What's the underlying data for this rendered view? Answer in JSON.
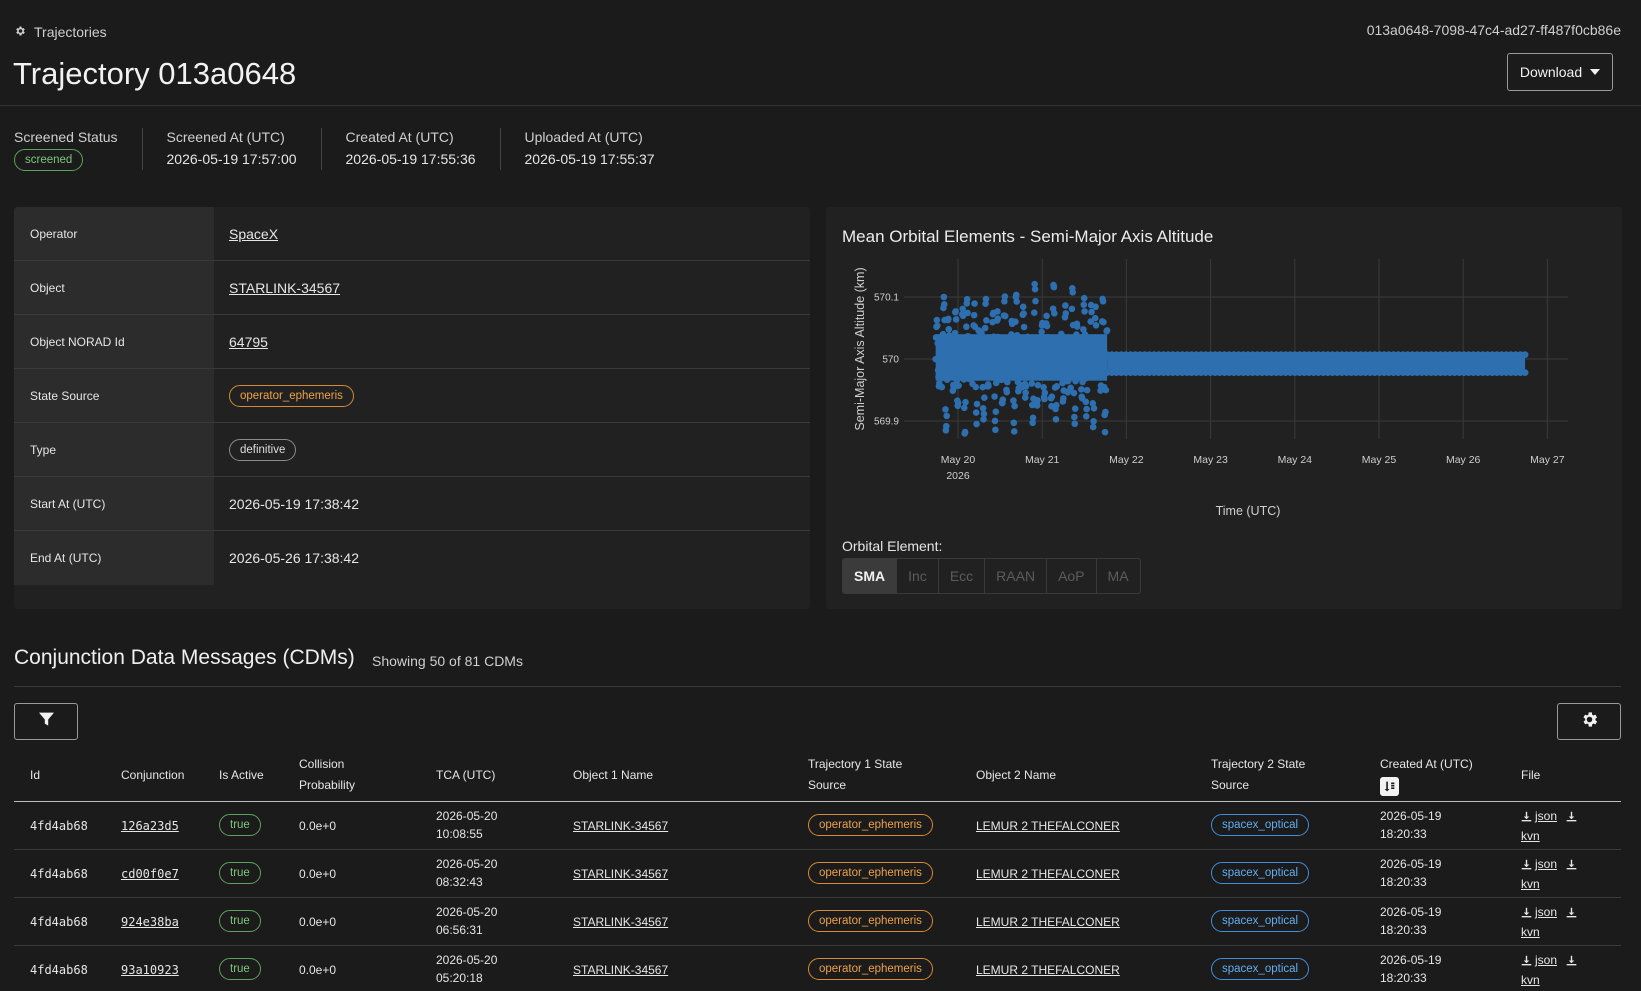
{
  "header": {
    "breadcrumb": "Trajectories",
    "title": "Trajectory 013a0648",
    "uuid": "013a0648-7098-47c4-ad27-ff487f0cb86e",
    "download_label": "Download"
  },
  "status": [
    {
      "label": "Screened Status",
      "badge": "screened"
    },
    {
      "label": "Screened At (UTC)",
      "value": "2026-05-19 17:57:00"
    },
    {
      "label": "Created At (UTC)",
      "value": "2026-05-19 17:55:36"
    },
    {
      "label": "Uploaded At (UTC)",
      "value": "2026-05-19 17:55:37"
    }
  ],
  "details": [
    {
      "key": "Operator",
      "value": "SpaceX"
    },
    {
      "key": "Object",
      "value": "STARLINK-34567"
    },
    {
      "key": "Object NORAD Id",
      "value": "64795"
    },
    {
      "key": "State Source",
      "value": "operator_ephemeris"
    },
    {
      "key": "Type",
      "value": "definitive"
    },
    {
      "key": "Start At (UTC)",
      "value": "2026-05-19 17:38:42"
    },
    {
      "key": "End At (UTC)",
      "value": "2026-05-26 17:38:42"
    }
  ],
  "chart": {
    "orbital_label": "Orbital Element:",
    "orbital_options": [
      "SMA",
      "Inc",
      "Ecc",
      "RAAN",
      "AoP",
      "MA"
    ],
    "orbital_selected": "SMA"
  },
  "chart_data": {
    "type": "scatter",
    "title": "Mean Orbital Elements - Semi-Major Axis Altitude",
    "xlabel": "Time (UTC)",
    "ylabel": "Semi-Major Axis Altitude (km)",
    "x_ticks": [
      "May 20",
      "May 21",
      "May 22",
      "May 23",
      "May 24",
      "May 25",
      "May 26",
      "May 27"
    ],
    "x_year_label": "2026",
    "y_ticks": [
      569.9,
      570,
      570.1
    ],
    "x_range": [
      "2026-05-19T17:38",
      "2026-05-27T00:00"
    ],
    "ylim": [
      569.87,
      570.15
    ],
    "grid": true,
    "color": "#2e6fb0",
    "series": [
      {
        "segment": "noisy",
        "x_range": [
          "2026-05-19T17:38",
          "2026-05-21T18:30"
        ],
        "y_range": [
          569.88,
          570.14
        ]
      },
      {
        "segment": "steady",
        "x_range": [
          "2026-05-21T18:30",
          "2026-05-26T17:38"
        ],
        "y_range": [
          569.98,
          570.005
        ]
      }
    ]
  },
  "cdm": {
    "title": "Conjunction Data Messages (CDMs)",
    "count_text": "Showing 50 of 81 CDMs",
    "columns": [
      {
        "l1": "Id"
      },
      {
        "l1": "Conjunction"
      },
      {
        "l1": "Is Active"
      },
      {
        "l1": "Collision",
        "l2": "Probability"
      },
      {
        "l1": "TCA (UTC)"
      },
      {
        "l1": "Object 1 Name"
      },
      {
        "l1": "Trajectory 1 State",
        "l2": "Source"
      },
      {
        "l1": "Object 2 Name"
      },
      {
        "l1": "Trajectory 2 State",
        "l2": "Source"
      },
      {
        "l1": "Created At (UTC)"
      },
      {
        "l1": "File"
      }
    ],
    "rows": [
      {
        "id": "4fd4ab68",
        "conj": "126a23d5",
        "active": "true",
        "prob": "0.0e+0",
        "tca_date": "2026-05-20",
        "tca_time": "10:08:55",
        "obj1": "STARLINK-34567",
        "src1": "operator_ephemeris",
        "obj2": "LEMUR 2 THEFALCONER",
        "src2": "spacex_optical",
        "created_date": "2026-05-19",
        "created_time": "18:20:33",
        "f1": "json",
        "f2": "kvn"
      },
      {
        "id": "4fd4ab68",
        "conj": "cd00f0e7",
        "active": "true",
        "prob": "0.0e+0",
        "tca_date": "2026-05-20",
        "tca_time": "08:32:43",
        "obj1": "STARLINK-34567",
        "src1": "operator_ephemeris",
        "obj2": "LEMUR 2 THEFALCONER",
        "src2": "spacex_optical",
        "created_date": "2026-05-19",
        "created_time": "18:20:33",
        "f1": "json",
        "f2": "kvn"
      },
      {
        "id": "4fd4ab68",
        "conj": "924e38ba",
        "active": "true",
        "prob": "0.0e+0",
        "tca_date": "2026-05-20",
        "tca_time": "06:56:31",
        "obj1": "STARLINK-34567",
        "src1": "operator_ephemeris",
        "obj2": "LEMUR 2 THEFALCONER",
        "src2": "spacex_optical",
        "created_date": "2026-05-19",
        "created_time": "18:20:33",
        "f1": "json",
        "f2": "kvn"
      },
      {
        "id": "4fd4ab68",
        "conj": "93a10923",
        "active": "true",
        "prob": "0.0e+0",
        "tca_date": "2026-05-20",
        "tca_time": "05:20:18",
        "obj1": "STARLINK-34567",
        "src1": "operator_ephemeris",
        "obj2": "LEMUR 2 THEFALCONER",
        "src2": "spacex_optical",
        "created_date": "2026-05-19",
        "created_time": "18:20:33",
        "f1": "json",
        "f2": "kvn"
      }
    ]
  },
  "colors": {
    "background": "#1b1b1b",
    "card": "#212121",
    "active_green": "#59a55a",
    "source_orange": "#d58a33",
    "source_blue": "#3f8fd6",
    "plot_blue": "#2e6fb0"
  },
  "icons": {
    "breadcrumb": "gear-icon",
    "download": "caret-down-icon",
    "filter": "filter-icon",
    "settings": "gear-icon",
    "sort": "sort-icon",
    "file": "download-icon"
  }
}
